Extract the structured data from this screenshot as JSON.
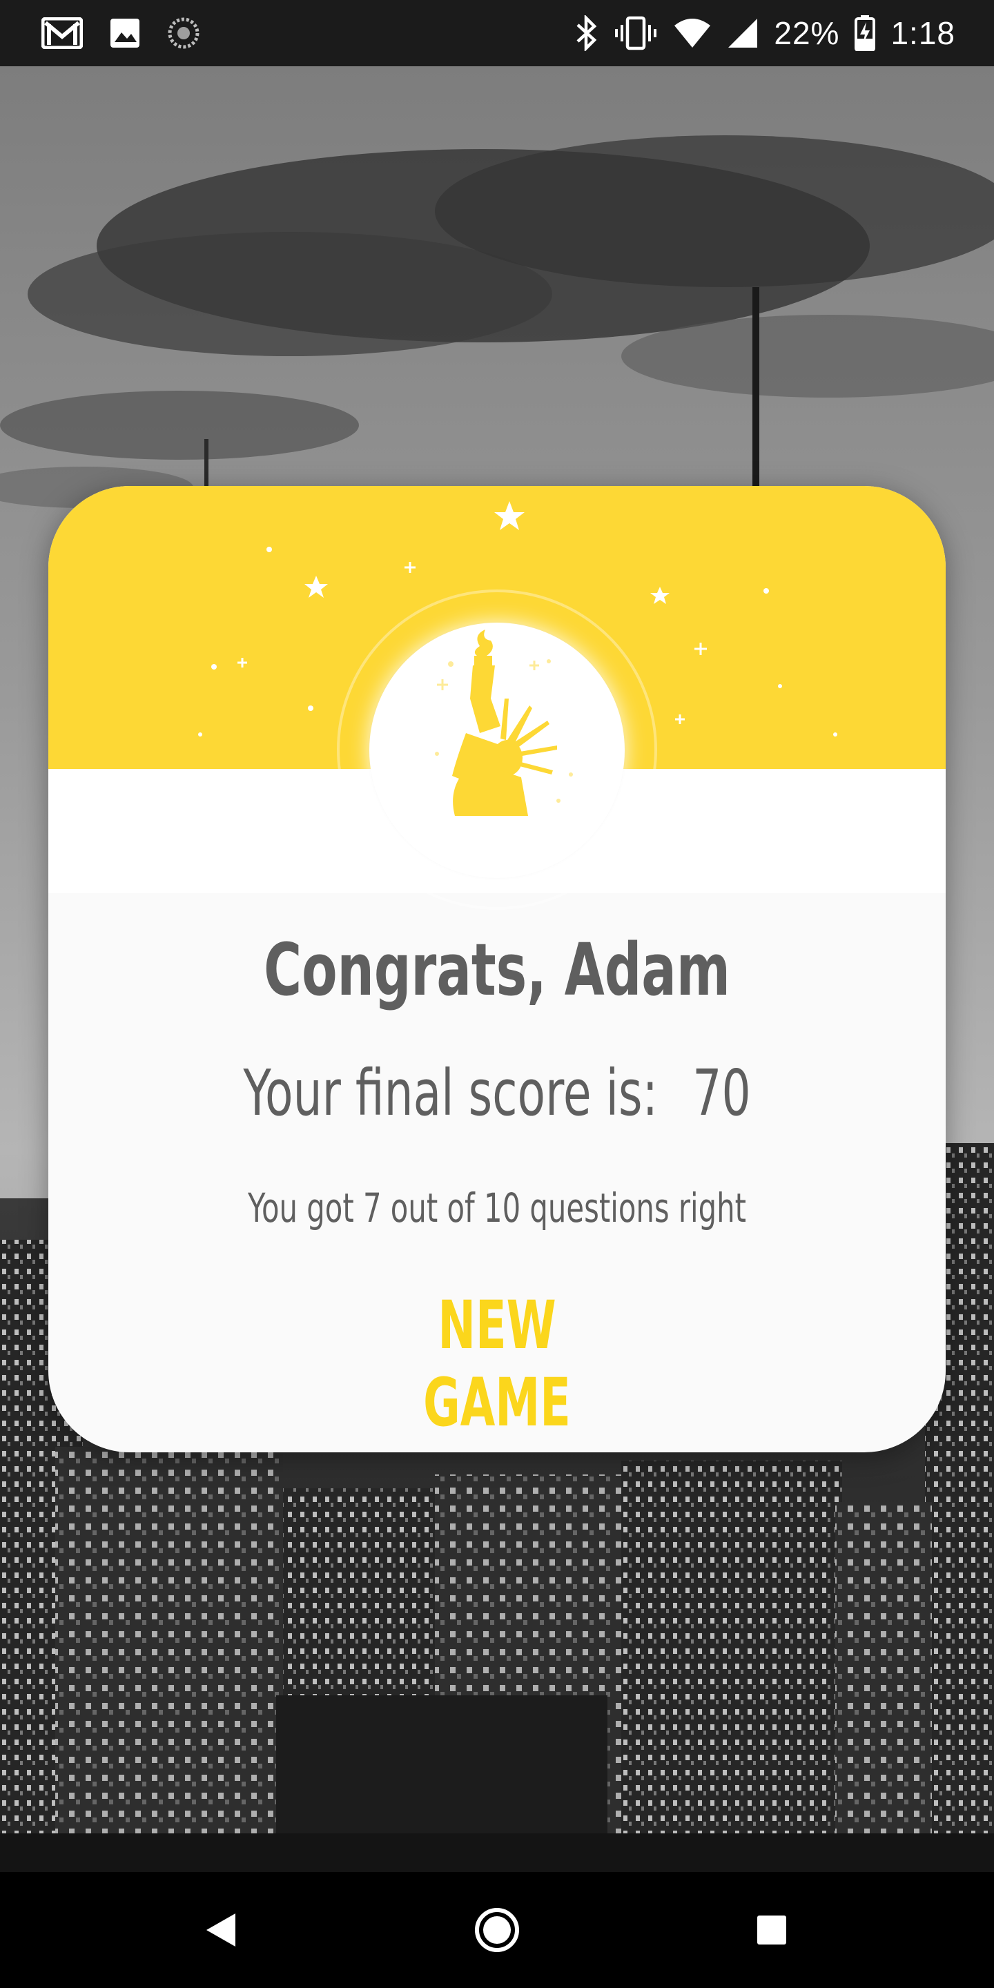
{
  "status_bar": {
    "battery_percent": "22%",
    "time": "1:18",
    "left_icons": [
      "gmail-icon",
      "image-icon",
      "sync-icon"
    ],
    "right_icons": [
      "bluetooth-icon",
      "vibrate-icon",
      "wifi-icon",
      "signal-icon",
      "battery-charging-icon"
    ]
  },
  "card": {
    "badge_icon": "statue-of-liberty-icon",
    "title": "Congrats, Adam",
    "score_label": "Your final score is:",
    "score_value": "70",
    "summary": "You got 7 out of 10 questions right",
    "new_game_label": "NEW GAME"
  },
  "colors": {
    "accent_yellow": "#fdd835",
    "text_gray": "#5f5f5f",
    "card_bg": "#fafafa"
  },
  "nav_bar": {
    "icons": [
      "back-icon",
      "home-icon",
      "recents-icon"
    ]
  }
}
